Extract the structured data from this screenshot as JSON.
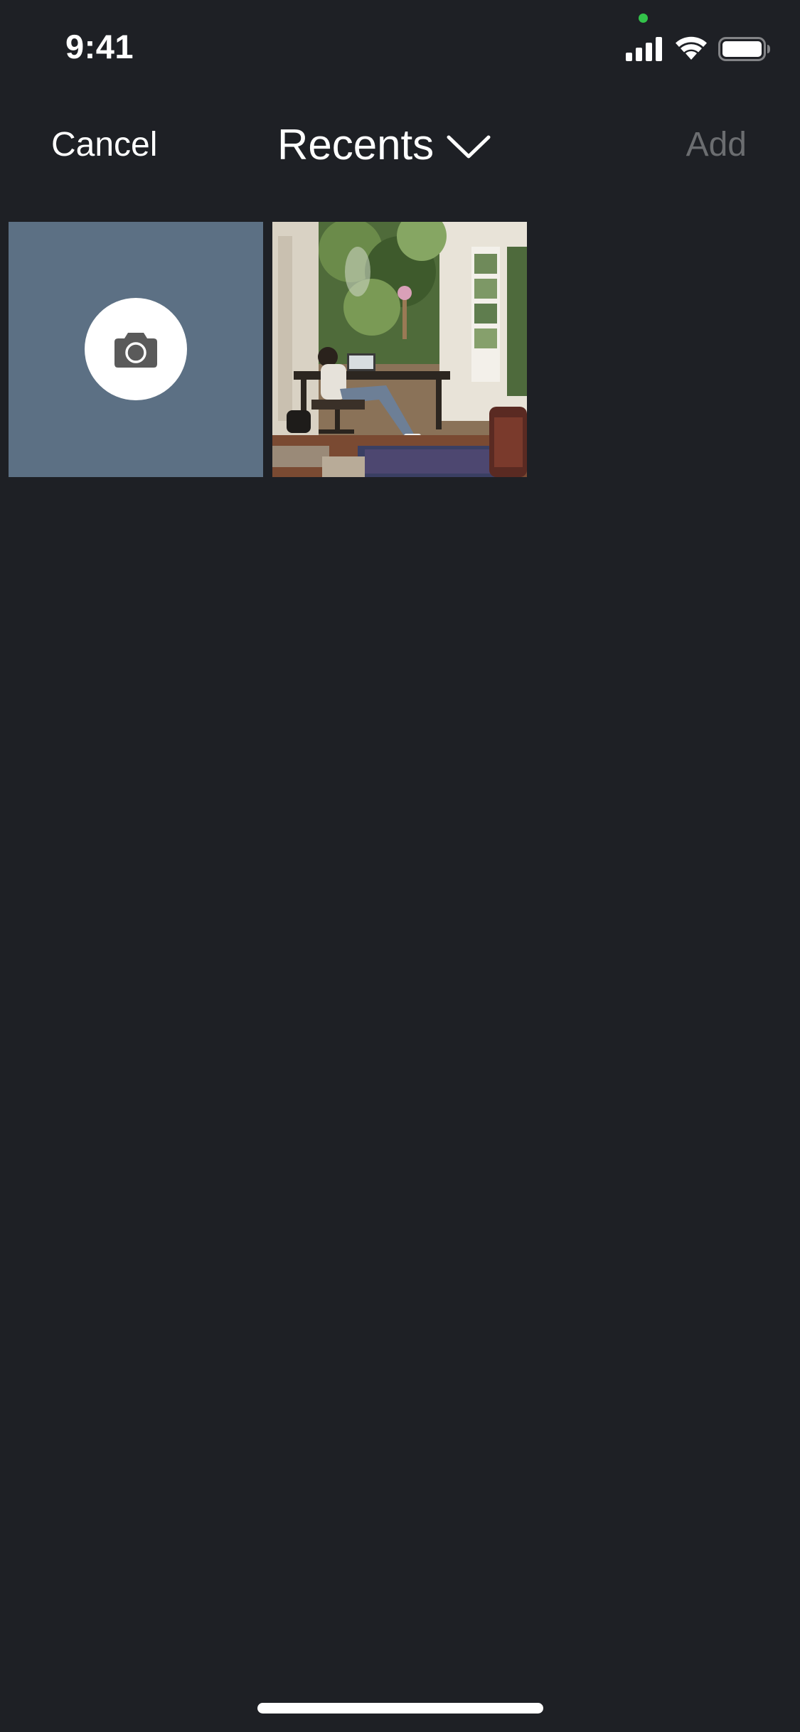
{
  "status_bar": {
    "time": "9:41",
    "icons": [
      "privacy-indicator-dot",
      "cellular-signal-icon",
      "wifi-icon",
      "battery-icon"
    ],
    "privacy_dot_color": "#33c24a"
  },
  "nav": {
    "cancel_label": "Cancel",
    "album_title": "Recents",
    "album_icon": "chevron-down-icon",
    "add_label": "Add",
    "add_enabled": false
  },
  "grid": {
    "items": [
      {
        "type": "camera",
        "icon": "camera-icon",
        "tile_color": "#5c7084"
      },
      {
        "type": "photo",
        "description_icon": "photo-thumbnail"
      }
    ]
  },
  "colors": {
    "background": "#1e2025",
    "text_primary": "#ffffff",
    "text_disabled": "#6b6d70"
  }
}
